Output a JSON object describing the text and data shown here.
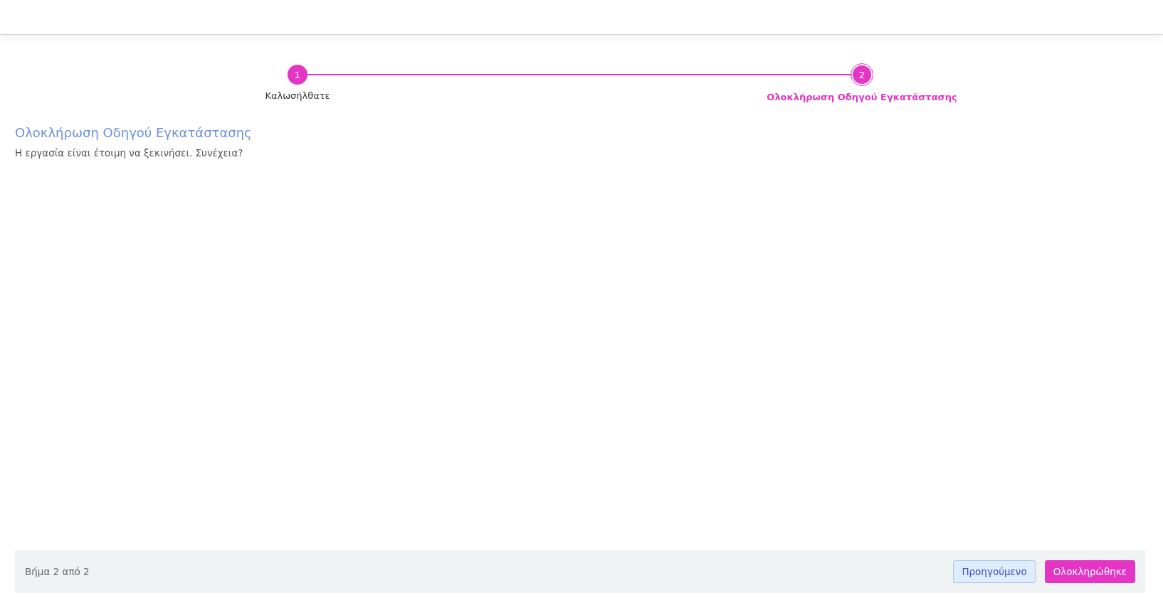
{
  "steps": [
    {
      "number": "1",
      "label": "Καλωσήλθατε",
      "selected": false
    },
    {
      "number": "2",
      "label": "Ολοκλήρωση Οδηγού Εγκατάστασης",
      "selected": true
    }
  ],
  "content": {
    "title": "Ολοκλήρωση Οδηγού Εγκατάστασης",
    "text": "Η εργασία είναι έτοιμη να ξεκινήσει. Συνέχεια?"
  },
  "footer": {
    "status": "Βήμα 2 από 2",
    "buttons": [
      {
        "label": "Προηγούμενο",
        "kind": "secondary"
      },
      {
        "label": "Ολοκληρώθηκε",
        "kind": "primary"
      }
    ]
  }
}
